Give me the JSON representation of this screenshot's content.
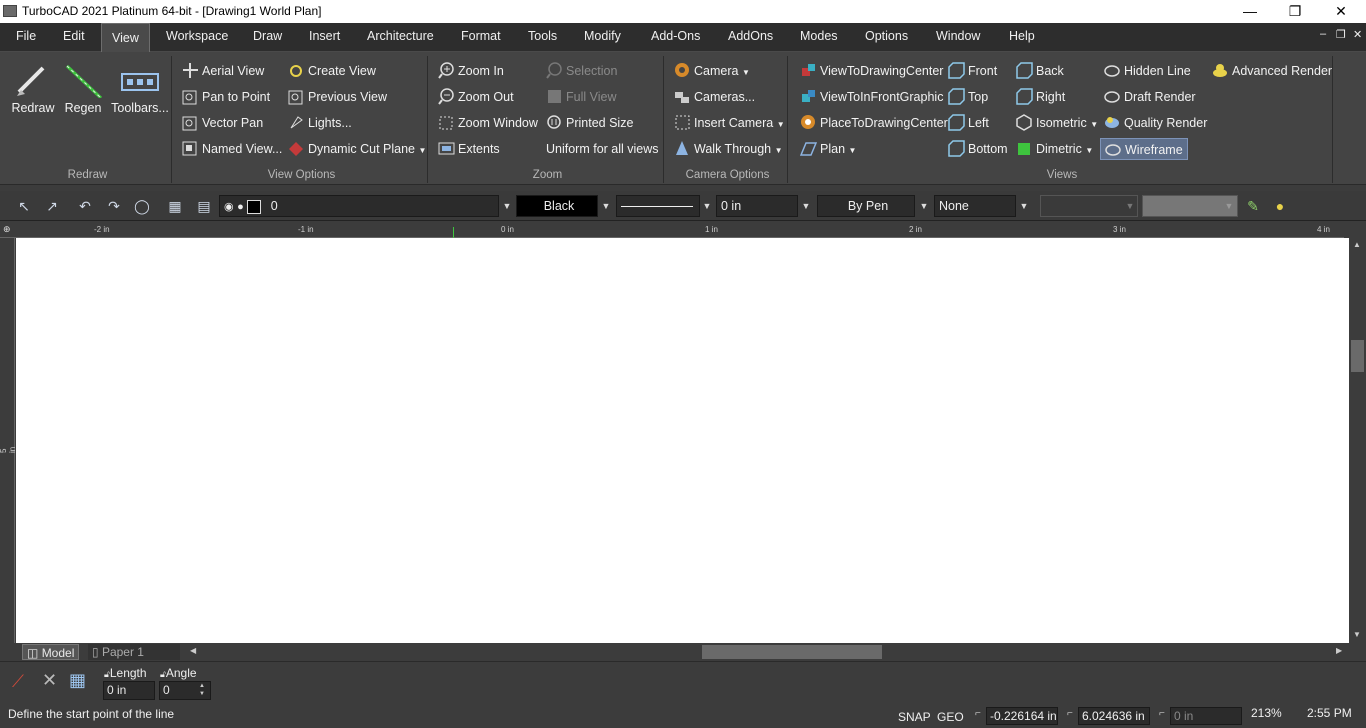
{
  "window": {
    "title": "TurboCAD 2021 Platinum 64-bit - [Drawing1 World Plan]",
    "minimize": "—",
    "restore": "❐",
    "close": "✕"
  },
  "menu": [
    "File",
    "Edit",
    "View",
    "Workspace",
    "Draw",
    "Insert",
    "Architecture",
    "Format",
    "Tools",
    "Modify",
    "Add-Ons",
    "AddOns",
    "Modes",
    "Options",
    "Window",
    "Help"
  ],
  "menu_active": "View",
  "mdi_controls": {
    "minimize": "–",
    "restore": "❐",
    "close": "✕"
  },
  "ribbon": {
    "redraw": {
      "title": "Redraw",
      "items": [
        "Redraw",
        "Regen",
        "Toolbars..."
      ]
    },
    "view_options": {
      "title": "View Options",
      "col1": [
        "Aerial View",
        "Pan to Point",
        "Vector Pan",
        "Named View..."
      ],
      "col2": [
        "Create View",
        "Previous View",
        "Lights...",
        "Dynamic Cut Plane"
      ]
    },
    "zoom": {
      "title": "Zoom",
      "col1": [
        "Zoom In",
        "Zoom Out",
        "Zoom Window",
        "Extents"
      ],
      "col2": [
        "Selection",
        "Full View",
        "Printed Size",
        "Uniform for all views"
      ]
    },
    "camera": {
      "title": "Camera Options",
      "items": [
        "Camera",
        "Cameras...",
        "Insert Camera",
        "Walk Through"
      ]
    },
    "views": {
      "title": "Views",
      "col1": [
        "ViewToDrawingCenter",
        "ViewToInFrontGraphic",
        "PlaceToDrawingCenter",
        "Plan"
      ],
      "col2": [
        "Front",
        "Top",
        "Left",
        "Bottom"
      ],
      "col3": [
        "Back",
        "Right",
        "Isometric",
        "Dimetric"
      ],
      "col4": [
        "Hidden Line",
        "Draft Render",
        "Quality Render",
        "Wireframe"
      ],
      "col5": [
        "Advanced Render"
      ]
    }
  },
  "toolbar": {
    "layer_value": "0",
    "color_value": "Black",
    "width_value": "0 in",
    "pen_value": "By Pen",
    "fill_value": "None"
  },
  "ruler": {
    "top": [
      "-2 in",
      "-1 in",
      "0 in",
      "1 in",
      "2 in",
      "3 in",
      "4 in"
    ],
    "left": "5 in"
  },
  "tabs": [
    "Model",
    "Paper 1"
  ],
  "input": {
    "length_label": "Length",
    "length_value": "0 in",
    "angle_label": "Angle",
    "angle_value": "0"
  },
  "status": {
    "message": "Define the start point of the line",
    "snap": "SNAP",
    "geo": "GEO",
    "x": "-0.226164 in",
    "y": "6.024636 in",
    "z": "0 in",
    "zoom": "213%",
    "time": "2:55 PM"
  },
  "colors": {
    "accent": "#5d6e8a",
    "canvas": "#ffffff",
    "chrome": "#444444"
  }
}
